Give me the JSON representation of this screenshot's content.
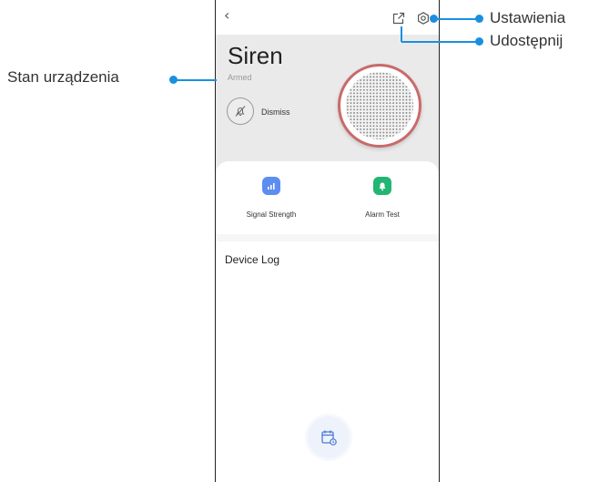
{
  "device": {
    "title": "Siren",
    "state": "Armed",
    "dismiss_label": "Dismiss"
  },
  "features": [
    {
      "label": "Signal Strength",
      "icon": "signal-strength-icon",
      "color": "#5b8ef0"
    },
    {
      "label": "Alarm Test",
      "icon": "bell-icon",
      "color": "#22b573"
    }
  ],
  "log": {
    "title": "Device Log"
  },
  "callouts": {
    "settings": "Ustawienia",
    "share": "Udostępnij",
    "device_state": "Stan urządzenia"
  },
  "colors": {
    "accent": "#1a8fe0",
    "siren_ring": "#c96a6a"
  }
}
